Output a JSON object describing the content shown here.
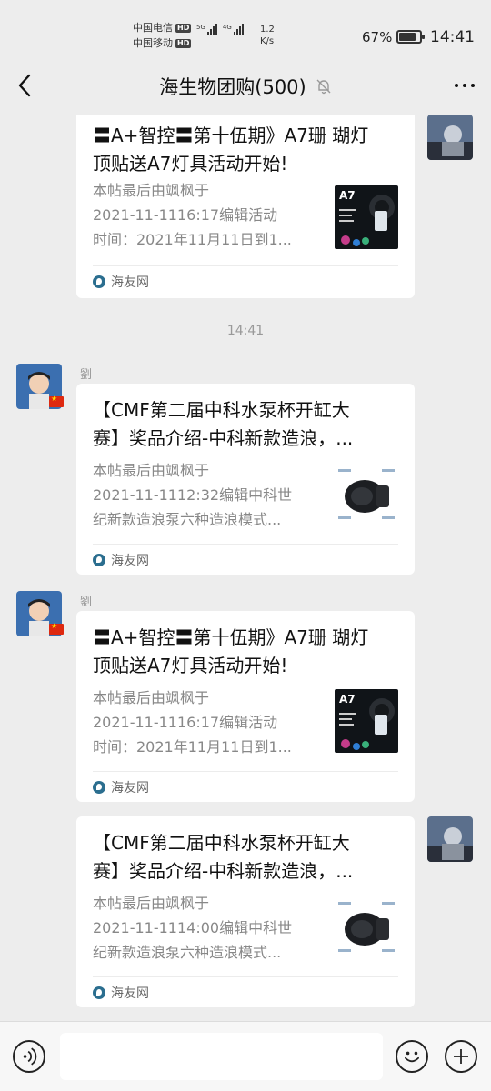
{
  "status_bar": {
    "carrier1": "中国电信",
    "carrier2": "中国移动",
    "hd_label": "HD",
    "net1": "5G",
    "net2": "4G",
    "speed_value": "1.2",
    "speed_unit": "K/s",
    "battery_percent": "67%",
    "battery_level": 0.67,
    "time": "14:41"
  },
  "header": {
    "title": "海生物团购(500)",
    "muted_icon": "bell-off-icon",
    "back_icon": "chevron-left-icon",
    "more_icon": "ellipsis-icon"
  },
  "messages": [
    {
      "sender": "self",
      "title_line1": "〓A+智控〓第十伍期》A7珊 瑚灯",
      "title_line2": "顶贴送A7灯具活动开始!",
      "desc_line1": "本帖最后由飒枫于",
      "desc_line2": "2021-11-1116:17编辑活动",
      "desc_line3": "时间：2021年11月11日到1...",
      "thumb_label": "A7",
      "source": "海友网"
    },
    {
      "sender": "劉",
      "title_line1": "【CMF第二届中科水泵杯开缸大",
      "title_line2": "赛】奖品介绍-中科新款造浪，...",
      "desc_line1": "本帖最后由飒枫于",
      "desc_line2": "2021-11-1112:32编辑中科世",
      "desc_line3": "纪新款造浪泵六种造浪模式...",
      "source": "海友网"
    },
    {
      "sender": "劉",
      "title_line1": "〓A+智控〓第十伍期》A7珊 瑚灯",
      "title_line2": "顶贴送A7灯具活动开始!",
      "desc_line1": "本帖最后由飒枫于",
      "desc_line2": "2021-11-1116:17编辑活动",
      "desc_line3": "时间：2021年11月11日到1...",
      "thumb_label": "A7",
      "source": "海友网"
    },
    {
      "sender": "self",
      "title_line1": "【CMF第二届中科水泵杯开缸大",
      "title_line2": "赛】奖品介绍-中科新款造浪，...",
      "desc_line1": "本帖最后由飒枫于",
      "desc_line2": "2021-11-1114:00编辑中科世",
      "desc_line3": "纪新款造浪泵六种造浪模式...",
      "source": "海友网"
    }
  ],
  "timestamp": "14:41",
  "input_bar": {
    "voice_icon": "voice-icon",
    "emoji_icon": "emoji-icon",
    "plus_icon": "plus-icon",
    "value": ""
  }
}
